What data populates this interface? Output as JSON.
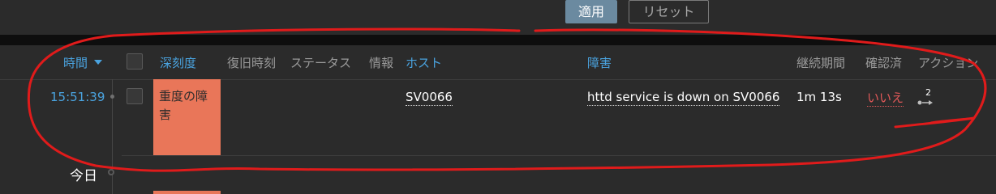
{
  "filter": {
    "apply_label": "適用",
    "reset_label": "リセット"
  },
  "header": {
    "time": "時間",
    "severity": "深刻度",
    "recovery_time": "復旧時刻",
    "status": "ステータス",
    "info": "情報",
    "host": "ホスト",
    "problem": "障害",
    "duration": "継続期間",
    "acknowledged": "確認済",
    "actions": "アクション"
  },
  "rows": [
    {
      "time": "15:51:39",
      "severity": "重度の障害",
      "severity_color": "#e97659",
      "host": "SV0066",
      "problem": "httd service is down on SV0066",
      "duration": "1m 13s",
      "ack": "いいえ",
      "actions_count": "2"
    }
  ],
  "separator": {
    "today": "今日"
  },
  "colors": {
    "link": "#4aa3df",
    "ack_no": "#e45959",
    "annotation": "#e01b1b"
  }
}
